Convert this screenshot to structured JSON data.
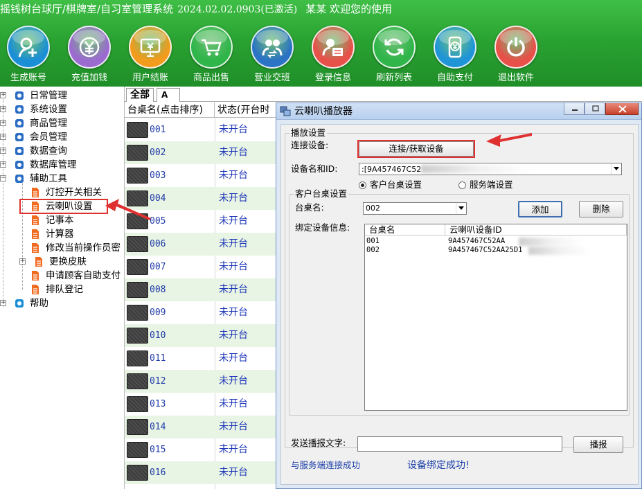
{
  "window": {
    "title": "摇钱树台球厅/棋牌室/自习室管理系统",
    "version": "2024.02.02.0903(已激活)",
    "user": "某某  欢迎您的使用"
  },
  "toolbar": [
    {
      "label": "生成账号",
      "icon": "add-user-icon",
      "color": "#1a8fd6"
    },
    {
      "label": "充值加钱",
      "icon": "yen-coin-icon",
      "color": "#9b6bd0"
    },
    {
      "label": "用户结账",
      "icon": "checkout-monitor-icon",
      "color": "#f39b1d"
    },
    {
      "label": "商品出售",
      "icon": "shopping-cart-icon",
      "color": "#2fb54a"
    },
    {
      "label": "营业交班",
      "icon": "shift-handover-icon",
      "color": "#2b73c4"
    },
    {
      "label": "登录信息",
      "icon": "login-info-icon",
      "color": "#e8504a"
    },
    {
      "label": "刷新列表",
      "icon": "refresh-icon",
      "color": "#2fb54a"
    },
    {
      "label": "自助支付",
      "icon": "self-pay-phone-icon",
      "color": "#1f95d8"
    },
    {
      "label": "退出软件",
      "icon": "power-icon",
      "color": "#e8504a"
    }
  ],
  "tree": {
    "roots": [
      "日常管理",
      "系统设置",
      "商品管理",
      "会员管理",
      "数据查询",
      "数据库管理",
      "辅助工具"
    ],
    "children": [
      "灯控开关相关",
      "云喇叭设置",
      "记事本",
      "计算器",
      "修改当前操作员密",
      "更换皮肤",
      "申请顾客自助支付",
      "排队登记"
    ],
    "help": "帮助"
  },
  "tabs": {
    "all": "全部",
    "a": "A"
  },
  "table": {
    "headers": [
      "台桌名(点击排序)",
      "状态(开台时"
    ],
    "rows": [
      {
        "id": "001",
        "status": "未开台"
      },
      {
        "id": "002",
        "status": "未开台"
      },
      {
        "id": "003",
        "status": "未开台"
      },
      {
        "id": "004",
        "status": "未开台"
      },
      {
        "id": "005",
        "status": "未开台"
      },
      {
        "id": "006",
        "status": "未开台"
      },
      {
        "id": "007",
        "status": "未开台"
      },
      {
        "id": "008",
        "status": "未开台"
      },
      {
        "id": "009",
        "status": "未开台"
      },
      {
        "id": "010",
        "status": "未开台"
      },
      {
        "id": "011",
        "status": "未开台"
      },
      {
        "id": "012",
        "status": "未开台"
      },
      {
        "id": "013",
        "status": "未开台"
      },
      {
        "id": "014",
        "status": "未开台"
      },
      {
        "id": "015",
        "status": "未开台"
      },
      {
        "id": "016",
        "status": "未开台"
      }
    ]
  },
  "dialog": {
    "title": "云喇叭播放器",
    "playback_group": "播放设置",
    "connect_label": "连接设备:",
    "connect_button": "连接/获取设备",
    "device_label": "设备名和ID:",
    "device_value": ":[9A457467C52",
    "device_value_tail": "",
    "radio_client": "客户台桌设置",
    "radio_server": "服务端设置",
    "client_group": "客户台桌设置",
    "table_label": "台桌名:",
    "table_value": "002",
    "add_button": "添加",
    "delete_button": "删除",
    "bind_label": "绑定设备信息:",
    "bind_headers": [
      "台桌名",
      "云喇叭设备ID"
    ],
    "bind_rows": [
      {
        "table": "001",
        "device": "9A457467C52AA"
      },
      {
        "table": "002",
        "device": "9A457467C52AA25D1"
      }
    ],
    "send_label": "发送播报文字:",
    "send_value": "",
    "broadcast_button": "播报",
    "status_left": "与服务端连接成功",
    "status_right": "设备绑定成功!"
  },
  "colors": {
    "banner": "#2aa332",
    "highlight": "#e03131",
    "row_alt": "#e8f4e4",
    "link_text": "#1c35b8"
  }
}
